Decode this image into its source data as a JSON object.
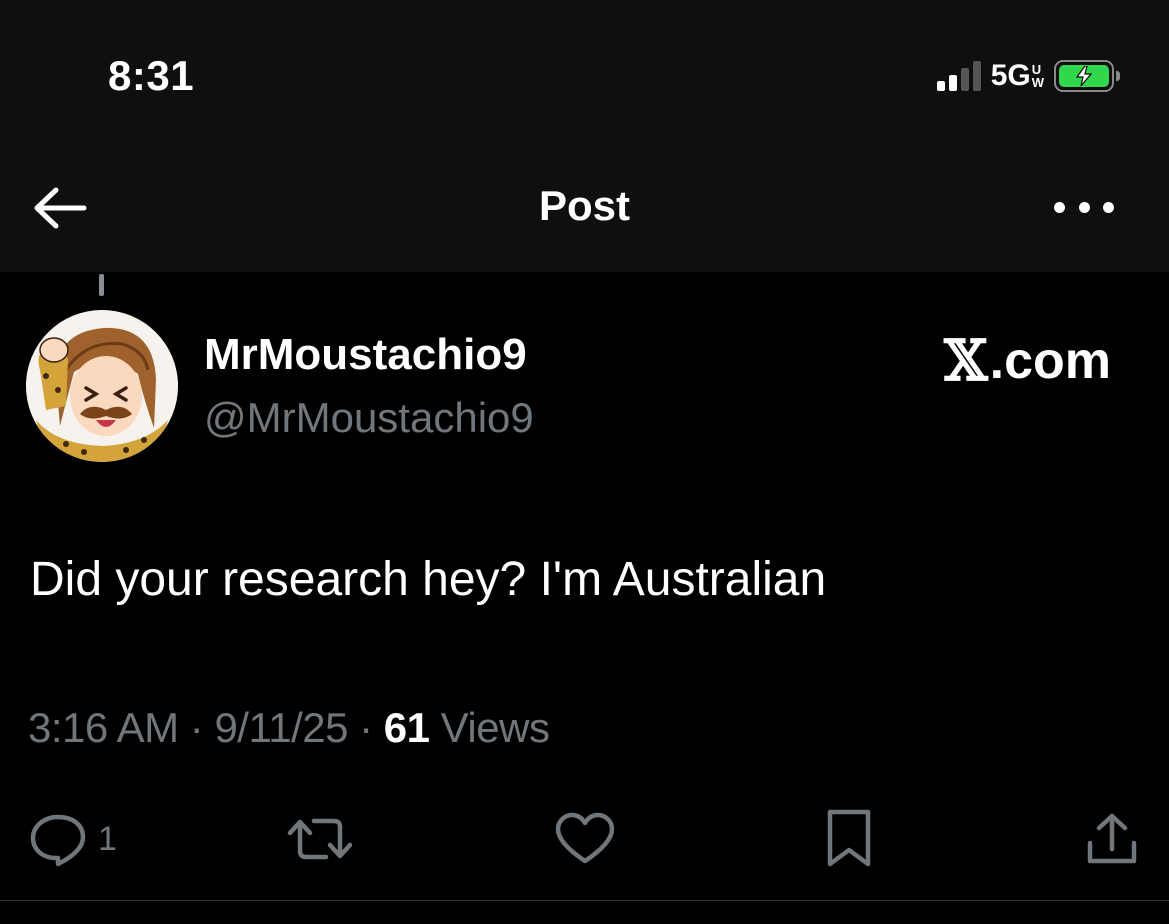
{
  "status_bar": {
    "time": "8:31",
    "network": "5G",
    "network_suffix_top": "U",
    "network_suffix_bottom": "W",
    "battery_color": "#32d74b"
  },
  "nav": {
    "back_icon": "arrow-left-icon",
    "title": "Post",
    "more_icon": "more-dots-icon"
  },
  "post": {
    "author": {
      "display_name": "MrMoustachio9",
      "handle": "@MrMoustachio9"
    },
    "source_mark": "𝕏",
    "source_text": ".com",
    "text": "Did your research hey? I'm Australian",
    "meta": {
      "time": "3:16 AM",
      "separator": " · ",
      "date": "9/11/25",
      "views_count": "61",
      "views_label": " Views"
    },
    "actions": {
      "reply_icon": "reply-icon",
      "reply_count": "1",
      "repost_icon": "repost-icon",
      "like_icon": "heart-icon",
      "bookmark_icon": "bookmark-icon",
      "share_icon": "share-icon"
    }
  },
  "colors": {
    "background": "#000000",
    "header_bg": "#0f0f10",
    "primary_text": "#ffffff",
    "secondary_text": "#71767b"
  }
}
